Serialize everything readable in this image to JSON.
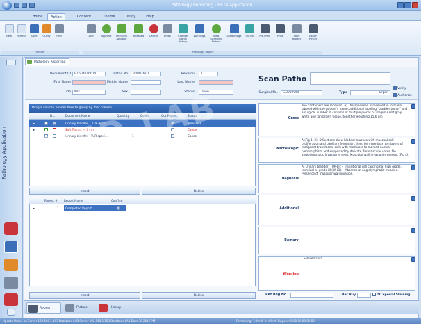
{
  "window": {
    "title": "Pathology Reporting - BETA application"
  },
  "tabs": [
    "Home",
    "Action",
    "Consent",
    "Theme",
    "Utility",
    "Help"
  ],
  "ribbon": {
    "groups": [
      {
        "label": "Header",
        "buttons": [
          "New",
          "Refresh",
          "Save",
          "Query",
          "Find"
        ]
      },
      {
        "label": "Pathology Report",
        "buttons": [
          "Open",
          "Approve",
          "Technical Approve",
          "Released",
          "Cancel",
          "Email",
          "Change Status History",
          "Warnings",
          "View Scanned Picture",
          "Load Image",
          "Full Text",
          "Pre-Print",
          "Print",
          "Save History",
          "Export Picture"
        ]
      }
    ],
    "colors": {
      "green": "#5fa83f",
      "blue": "#3b6fb8",
      "red": "#c8343a",
      "orange": "#e08a2c",
      "gray": "#7a8aa0",
      "teal": "#3aa3a3"
    }
  },
  "document_tab": {
    "label": "Pathology Reporting"
  },
  "header": {
    "document_id_label": "Document ID",
    "document_id": "P.1604016010",
    "patho_no_label": "Patho No",
    "patho_no": "P.0801610",
    "revision_label": "Revision",
    "revision": "1",
    "first_name_label": "First Name",
    "first_name": "",
    "middle_name_label": "Middle Name",
    "middle_name": "",
    "last_name_label": "Last Name",
    "last_name": "",
    "title_label": "Title",
    "title": "Mrs",
    "sex_label": "Sex",
    "sex": "",
    "status_label": "Status",
    "status": "Open",
    "scan_title": "Scan Patho",
    "surgical_no_label": "Surgical No.",
    "surgical_no": "S.0002065",
    "type_label": "Type",
    "type": "Organ",
    "verify_label": "Verify",
    "authorize_label": "Authorize"
  },
  "grid1": {
    "group_hint": "Drag a column header here to group by that column",
    "columns": [
      "D...",
      "Document Name",
      "Quantity",
      "Collet",
      "Out Report",
      "Status"
    ],
    "rows": [
      {
        "name": "Urinary bladder, ..TUR-BT,U...",
        "quantity": "",
        "status": "Released",
        "style": "selected"
      },
      {
        "name": "Soft Tissue, < 2 cm",
        "quantity": "",
        "status": "Cancel",
        "style": "red"
      },
      {
        "name": "Urinary bladder --TUR speci...",
        "quantity": "1",
        "status": "Cancel",
        "style": "normal"
      }
    ],
    "insert_label": "Insert",
    "delete_label": "Delete"
  },
  "grid2": {
    "columns": [
      "Report #",
      "Report Name",
      "Confirm"
    ],
    "rows": [
      {
        "number": "1",
        "name": "Completed Report"
      }
    ],
    "insert_label": "Insert",
    "delete_label": "Delete"
  },
  "report": {
    "gross_label": "Gross",
    "gross_text": "Two containers are received. A) The specimen is received in formalin, labeled with the patient's name, additional labeling \"bladder tumor\" and a surgical number. It consists of multiple pieces of irregular soft gray white and tan brown tissue, together weighing 15.6 gm.",
    "microscopic_label": "Microscopic",
    "microscopic_text": "A (Fig 1, 2): D Sections show bladder mucosa with mucosal cell proliferation and papillary formation, lined by more than ten layers of malignant transitional cells with moderate to marked nuclear pleomorphism and supported by delicate fibrovascular cores. No angiolymphatic invasion is seen. Muscular wall invasion is present (Fig 4).",
    "diagnosis_label": "Diagnosis",
    "diagnosis_text": "A) Urinary bladder, TUR-BT: - Transitional cell carcinoma, high grade, identical to grade III (WHO). - Absence of angiolymphatic invasion. - Presence of muscular wall invasion.",
    "additional_label": "Additional",
    "additional_text": "",
    "remark_label": "Remark",
    "remark_text": "",
    "warning_label": "Warning",
    "warning_text": "&Recentdata",
    "ref_reg_label": "Ref Reg No.",
    "ref_reg_value": "",
    "ref_buy_label": "Ref Buy",
    "ref_buy_value": "",
    "dc_special_label": "DC Special Staining"
  },
  "left_panel": {
    "title": "Pathology Application"
  },
  "bottom_tabs": [
    "Report",
    "Picture",
    "History"
  ],
  "status": {
    "left": "Update Status on Server 192.168.1.103 Database LAB  Server 192.168.1.103 Database LAB  Date 30 2016 PM",
    "right": "Remaining: 1:00:00 24:00:00  Elapsed: 0:00:00 00:00:00"
  },
  "watermark": "MED LAB"
}
